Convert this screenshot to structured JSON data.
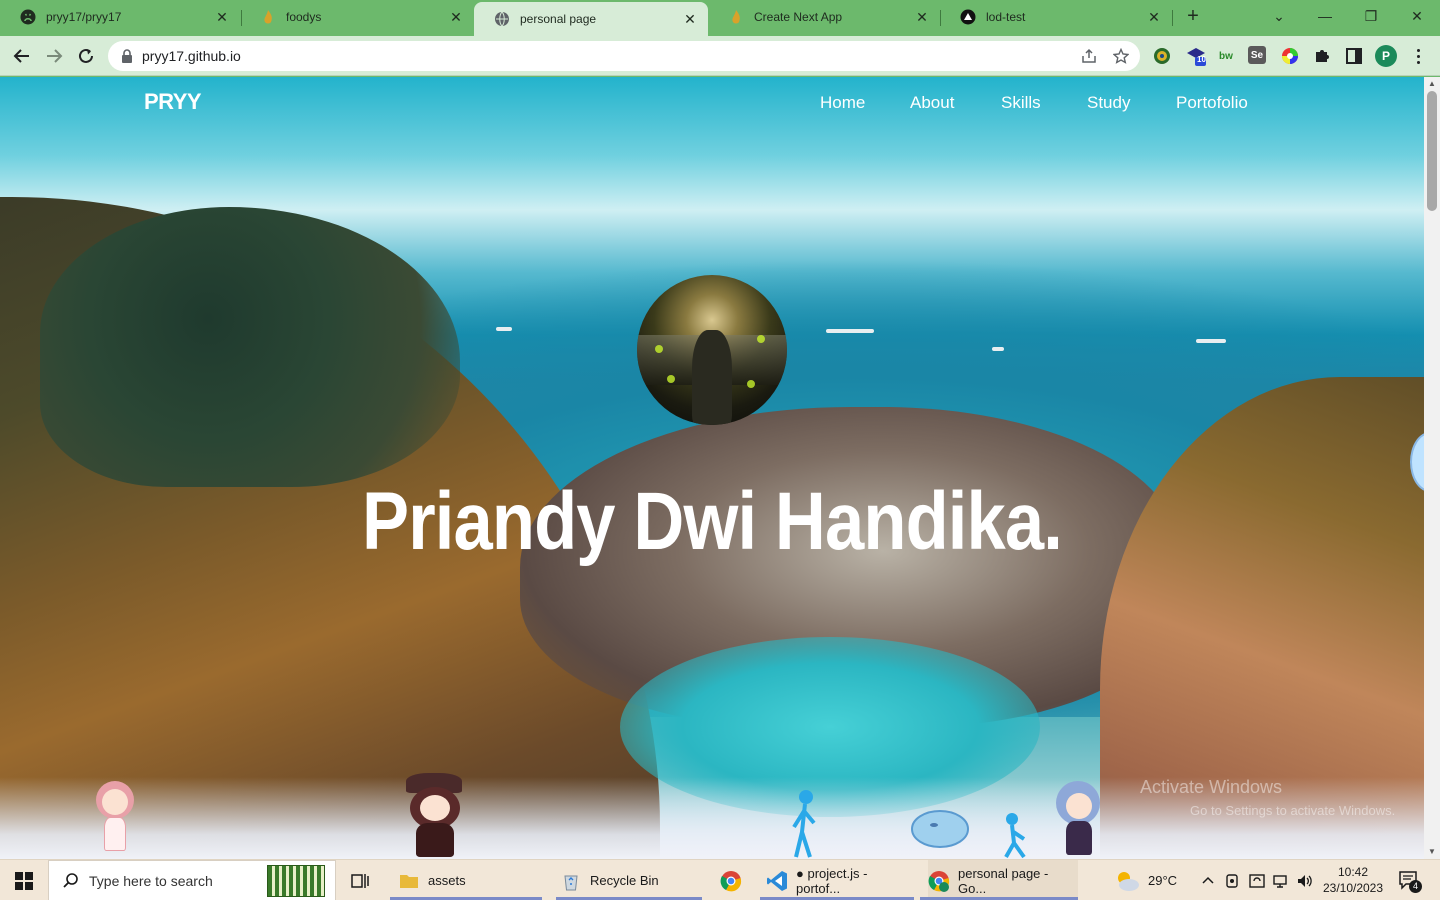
{
  "tabs": [
    {
      "label": "pryy17/pryy17",
      "icon": "github-icon"
    },
    {
      "label": "foodys",
      "icon": "flame-icon"
    },
    {
      "label": "personal page",
      "icon": "globe-icon"
    },
    {
      "label": "Create Next App",
      "icon": "flame-icon"
    },
    {
      "label": "lod-test",
      "icon": "triangle-icon"
    }
  ],
  "active_tab_index": 2,
  "tab_close_glyph": "✕",
  "new_tab_glyph": "+",
  "window_controls": {
    "dropdown": "⌄",
    "minimize": "—",
    "restore": "❐",
    "close": "✕"
  },
  "address_bar": {
    "url": "pryy17.github.io"
  },
  "extensions": {
    "badge_count": "10",
    "bw_label": "bw",
    "se_label": "Se"
  },
  "profile_initial": "P",
  "site": {
    "brand": "PRYY",
    "nav": [
      "Home",
      "About",
      "Skills",
      "Study",
      "Portofolio"
    ],
    "hero_name": "Priandy Dwi Handika.",
    "watermark_line1": "Activate Windows",
    "watermark_line2": "Go to Settings to activate Windows."
  },
  "taskbar": {
    "search_placeholder": "Type here to search",
    "apps": [
      {
        "label": "assets",
        "icon": "folder-icon"
      },
      {
        "label": "Recycle Bin",
        "icon": "recycle-bin-icon"
      },
      {
        "label": "",
        "icon": "chrome-icon"
      },
      {
        "label": "● project.js - portof...",
        "icon": "vscode-icon"
      },
      {
        "label": "personal page - Go...",
        "icon": "chrome-icon"
      }
    ],
    "weather": "29°C",
    "time": "10:42",
    "date": "23/10/2023",
    "notification_count": "4"
  },
  "colors": {
    "tab_strip": "#6cb96c",
    "toolbar": "#d7ecd7",
    "taskbar": "#f2e7d8",
    "profile": "#1b8a5a"
  }
}
